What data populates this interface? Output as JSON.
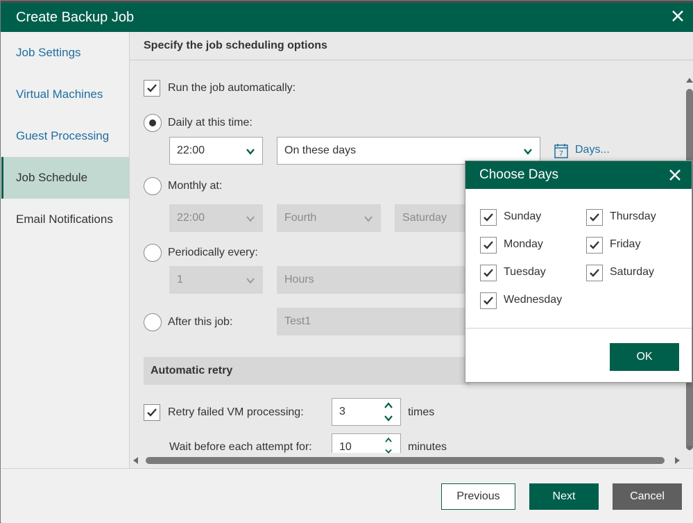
{
  "window": {
    "title": "Create Backup Job"
  },
  "sidebar": {
    "items": [
      {
        "label": "Job Settings"
      },
      {
        "label": "Virtual Machines"
      },
      {
        "label": "Guest Processing"
      },
      {
        "label": "Job Schedule",
        "current": true
      },
      {
        "label": "Email Notifications"
      }
    ]
  },
  "main": {
    "header": "Specify the job scheduling options",
    "run_automatically": {
      "label": "Run the job automatically:",
      "checked": true
    },
    "daily": {
      "label": "Daily at this time:",
      "selected": true,
      "time": "22:00",
      "days_mode": "On these days",
      "days_link": "Days..."
    },
    "monthly": {
      "label": "Monthly at:",
      "time": "22:00",
      "week": "Fourth",
      "day": "Saturday"
    },
    "periodically": {
      "label": "Periodically every:",
      "value": "1",
      "unit": "Hours"
    },
    "after_job": {
      "label": "After this job:",
      "job": "Test1"
    },
    "retry_section": "Automatic retry",
    "retry": {
      "label": "Retry failed VM processing:",
      "checked": true,
      "value": "3",
      "unit": "times"
    },
    "wait": {
      "label": "Wait before each attempt for:",
      "value": "10",
      "unit": "minutes"
    }
  },
  "footer": {
    "previous": "Previous",
    "next": "Next",
    "cancel": "Cancel"
  },
  "dialog": {
    "title": "Choose Days",
    "days": [
      {
        "label": "Sunday",
        "checked": true
      },
      {
        "label": "Monday",
        "checked": true
      },
      {
        "label": "Tuesday",
        "checked": true
      },
      {
        "label": "Wednesday",
        "checked": true
      },
      {
        "label": "Thursday",
        "checked": true
      },
      {
        "label": "Friday",
        "checked": true
      },
      {
        "label": "Saturday",
        "checked": true
      }
    ],
    "ok": "OK"
  },
  "colors": {
    "brand": "#005f4b",
    "link": "#1f6fa0",
    "selected_nav": "#c2d9d2",
    "cancel": "#5f5f5f"
  }
}
